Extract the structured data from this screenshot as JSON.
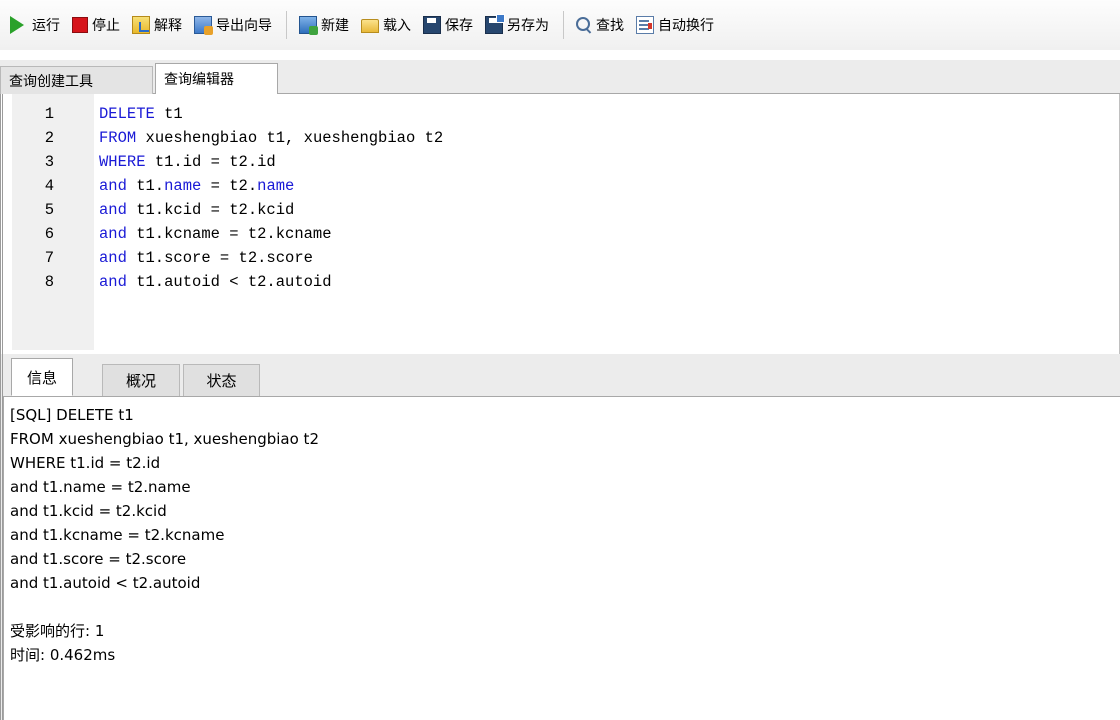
{
  "toolbar": {
    "run": "运行",
    "stop": "停止",
    "explain": "解释",
    "export_wizard": "导出向导",
    "new": "新建",
    "load": "载入",
    "save": "保存",
    "save_as": "另存为",
    "find": "查找",
    "word_wrap": "自动换行"
  },
  "top_tabs": [
    {
      "label": "查询创建工具",
      "active": false
    },
    {
      "label": "查询编辑器",
      "active": true
    }
  ],
  "editor": {
    "lines": [
      {
        "no": "1",
        "keyword": "DELETE",
        "rest": " t1"
      },
      {
        "no": "2",
        "keyword": "FROM",
        "rest": " xueshengbiao t1, xueshengbiao t2"
      },
      {
        "no": "3",
        "keyword": "WHERE",
        "rest": " t1.id = t2.id"
      },
      {
        "no": "4",
        "keyword": "and",
        "rest": " t1.",
        "kw2": "name",
        "rest2": " = t2.",
        "kw3": "name"
      },
      {
        "no": "5",
        "keyword": "and",
        "rest": " t1.kcid = t2.kcid"
      },
      {
        "no": "6",
        "keyword": "and",
        "rest": " t1.kcname = t2.kcname"
      },
      {
        "no": "7",
        "keyword": "and",
        "rest": " t1.score = t2.score"
      },
      {
        "no": "8",
        "keyword": "and",
        "rest": " t1.autoid < t2.autoid"
      }
    ]
  },
  "bottom_tabs": [
    {
      "label": "信息",
      "active": true
    },
    {
      "label": "概况",
      "active": false
    },
    {
      "label": "状态",
      "active": false
    }
  ],
  "messages": [
    "[SQL] DELETE t1",
    "FROM xueshengbiao t1, xueshengbiao t2",
    "WHERE t1.id = t2.id",
    "and t1.name = t2.name",
    "and t1.kcid = t2.kcid",
    "and t1.kcname = t2.kcname",
    "and t1.score = t2.score",
    "and t1.autoid < t2.autoid",
    "",
    "受影响的行: 1",
    "时间: 0.462ms"
  ],
  "colors": {
    "keyword": "#1a1ad6",
    "run_icon": "#2aa12a",
    "stop_icon": "#d6141b"
  },
  "icons": {
    "run": "play-icon",
    "stop": "stop-icon",
    "explain": "explain-icon",
    "export_wizard": "export-icon",
    "new": "new-query-icon",
    "load": "folder-icon",
    "save": "save-icon",
    "save_as": "save-as-icon",
    "find": "search-icon",
    "word_wrap": "word-wrap-icon"
  }
}
